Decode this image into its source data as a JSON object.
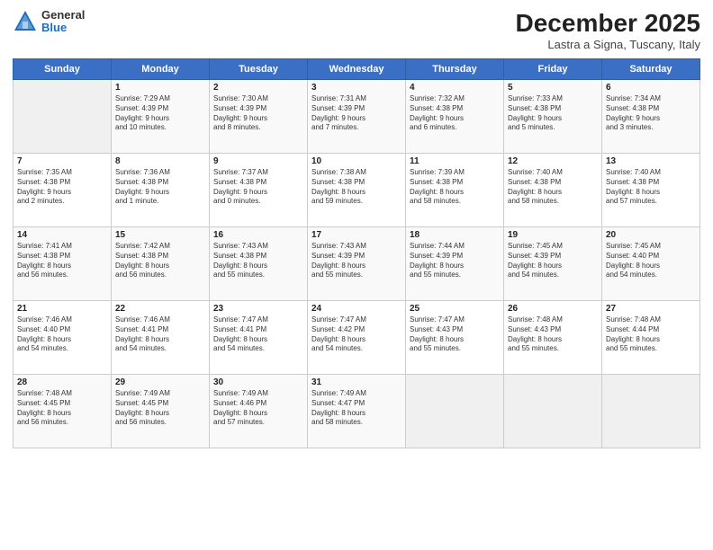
{
  "header": {
    "logo_general": "General",
    "logo_blue": "Blue",
    "month": "December 2025",
    "location": "Lastra a Signa, Tuscany, Italy"
  },
  "days_of_week": [
    "Sunday",
    "Monday",
    "Tuesday",
    "Wednesday",
    "Thursday",
    "Friday",
    "Saturday"
  ],
  "weeks": [
    [
      {
        "day": "",
        "info": ""
      },
      {
        "day": "1",
        "info": "Sunrise: 7:29 AM\nSunset: 4:39 PM\nDaylight: 9 hours\nand 10 minutes."
      },
      {
        "day": "2",
        "info": "Sunrise: 7:30 AM\nSunset: 4:39 PM\nDaylight: 9 hours\nand 8 minutes."
      },
      {
        "day": "3",
        "info": "Sunrise: 7:31 AM\nSunset: 4:39 PM\nDaylight: 9 hours\nand 7 minutes."
      },
      {
        "day": "4",
        "info": "Sunrise: 7:32 AM\nSunset: 4:38 PM\nDaylight: 9 hours\nand 6 minutes."
      },
      {
        "day": "5",
        "info": "Sunrise: 7:33 AM\nSunset: 4:38 PM\nDaylight: 9 hours\nand 5 minutes."
      },
      {
        "day": "6",
        "info": "Sunrise: 7:34 AM\nSunset: 4:38 PM\nDaylight: 9 hours\nand 3 minutes."
      }
    ],
    [
      {
        "day": "7",
        "info": "Sunrise: 7:35 AM\nSunset: 4:38 PM\nDaylight: 9 hours\nand 2 minutes."
      },
      {
        "day": "8",
        "info": "Sunrise: 7:36 AM\nSunset: 4:38 PM\nDaylight: 9 hours\nand 1 minute."
      },
      {
        "day": "9",
        "info": "Sunrise: 7:37 AM\nSunset: 4:38 PM\nDaylight: 9 hours\nand 0 minutes."
      },
      {
        "day": "10",
        "info": "Sunrise: 7:38 AM\nSunset: 4:38 PM\nDaylight: 8 hours\nand 59 minutes."
      },
      {
        "day": "11",
        "info": "Sunrise: 7:39 AM\nSunset: 4:38 PM\nDaylight: 8 hours\nand 58 minutes."
      },
      {
        "day": "12",
        "info": "Sunrise: 7:40 AM\nSunset: 4:38 PM\nDaylight: 8 hours\nand 58 minutes."
      },
      {
        "day": "13",
        "info": "Sunrise: 7:40 AM\nSunset: 4:38 PM\nDaylight: 8 hours\nand 57 minutes."
      }
    ],
    [
      {
        "day": "14",
        "info": "Sunrise: 7:41 AM\nSunset: 4:38 PM\nDaylight: 8 hours\nand 56 minutes."
      },
      {
        "day": "15",
        "info": "Sunrise: 7:42 AM\nSunset: 4:38 PM\nDaylight: 8 hours\nand 56 minutes."
      },
      {
        "day": "16",
        "info": "Sunrise: 7:43 AM\nSunset: 4:38 PM\nDaylight: 8 hours\nand 55 minutes."
      },
      {
        "day": "17",
        "info": "Sunrise: 7:43 AM\nSunset: 4:39 PM\nDaylight: 8 hours\nand 55 minutes."
      },
      {
        "day": "18",
        "info": "Sunrise: 7:44 AM\nSunset: 4:39 PM\nDaylight: 8 hours\nand 55 minutes."
      },
      {
        "day": "19",
        "info": "Sunrise: 7:45 AM\nSunset: 4:39 PM\nDaylight: 8 hours\nand 54 minutes."
      },
      {
        "day": "20",
        "info": "Sunrise: 7:45 AM\nSunset: 4:40 PM\nDaylight: 8 hours\nand 54 minutes."
      }
    ],
    [
      {
        "day": "21",
        "info": "Sunrise: 7:46 AM\nSunset: 4:40 PM\nDaylight: 8 hours\nand 54 minutes."
      },
      {
        "day": "22",
        "info": "Sunrise: 7:46 AM\nSunset: 4:41 PM\nDaylight: 8 hours\nand 54 minutes."
      },
      {
        "day": "23",
        "info": "Sunrise: 7:47 AM\nSunset: 4:41 PM\nDaylight: 8 hours\nand 54 minutes."
      },
      {
        "day": "24",
        "info": "Sunrise: 7:47 AM\nSunset: 4:42 PM\nDaylight: 8 hours\nand 54 minutes."
      },
      {
        "day": "25",
        "info": "Sunrise: 7:47 AM\nSunset: 4:43 PM\nDaylight: 8 hours\nand 55 minutes."
      },
      {
        "day": "26",
        "info": "Sunrise: 7:48 AM\nSunset: 4:43 PM\nDaylight: 8 hours\nand 55 minutes."
      },
      {
        "day": "27",
        "info": "Sunrise: 7:48 AM\nSunset: 4:44 PM\nDaylight: 8 hours\nand 55 minutes."
      }
    ],
    [
      {
        "day": "28",
        "info": "Sunrise: 7:48 AM\nSunset: 4:45 PM\nDaylight: 8 hours\nand 56 minutes."
      },
      {
        "day": "29",
        "info": "Sunrise: 7:49 AM\nSunset: 4:45 PM\nDaylight: 8 hours\nand 56 minutes."
      },
      {
        "day": "30",
        "info": "Sunrise: 7:49 AM\nSunset: 4:46 PM\nDaylight: 8 hours\nand 57 minutes."
      },
      {
        "day": "31",
        "info": "Sunrise: 7:49 AM\nSunset: 4:47 PM\nDaylight: 8 hours\nand 58 minutes."
      },
      {
        "day": "",
        "info": ""
      },
      {
        "day": "",
        "info": ""
      },
      {
        "day": "",
        "info": ""
      }
    ]
  ]
}
